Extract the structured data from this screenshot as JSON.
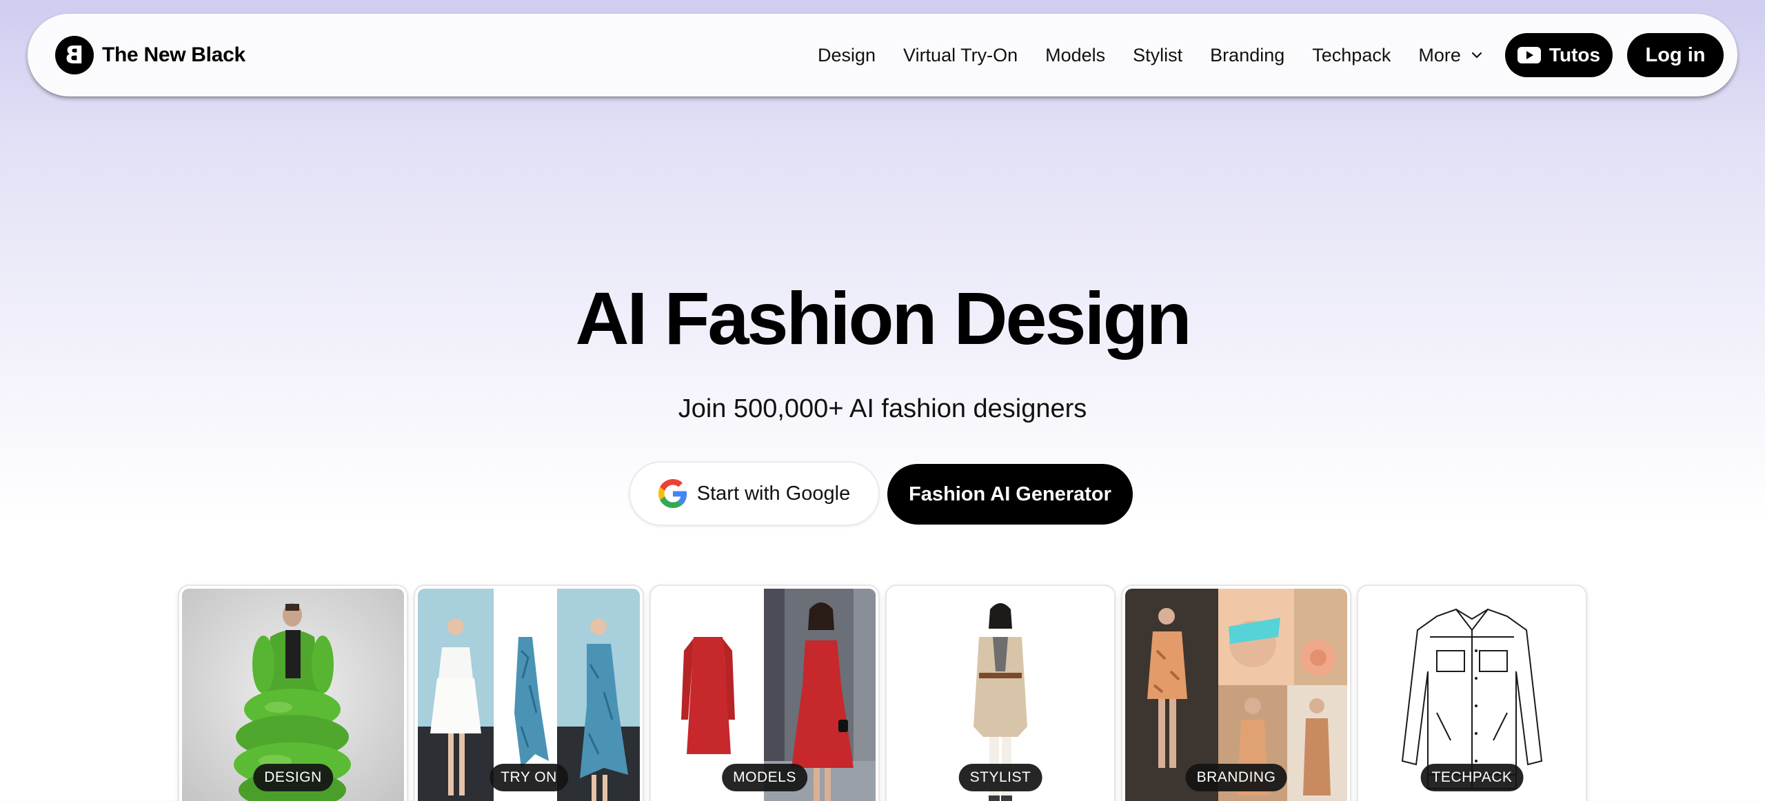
{
  "brand": {
    "logo_letter": "B",
    "name": "The New Black"
  },
  "nav": {
    "links": [
      "Design",
      "Virtual Try-On",
      "Models",
      "Stylist",
      "Branding",
      "Techpack"
    ],
    "more_label": "More",
    "more_icon": "chevron-down-icon",
    "tutos_label": "Tutos",
    "tutos_icon": "youtube-icon",
    "login_label": "Log in"
  },
  "hero": {
    "title": "AI Fashion Design",
    "subtitle": "Join 500,000+ AI fashion designers",
    "google_button": "Start with Google",
    "google_icon": "google-icon",
    "generator_button": "Fashion AI Generator"
  },
  "cards": [
    {
      "badge": "DESIGN",
      "image": "green-puffer-coat"
    },
    {
      "badge": "TRY ON",
      "image": "blue-dress-try-on"
    },
    {
      "badge": "MODELS",
      "image": "red-floral-dress"
    },
    {
      "badge": "STYLIST",
      "image": "beige-coat-outfit"
    },
    {
      "badge": "BRANDING",
      "image": "floral-moodboard"
    },
    {
      "badge": "TECHPACK",
      "image": "denim-jacket-sketch"
    }
  ],
  "colors": {
    "primary": "#000000",
    "background_top": "#cfcdf0",
    "background_bottom": "#ffffff"
  }
}
